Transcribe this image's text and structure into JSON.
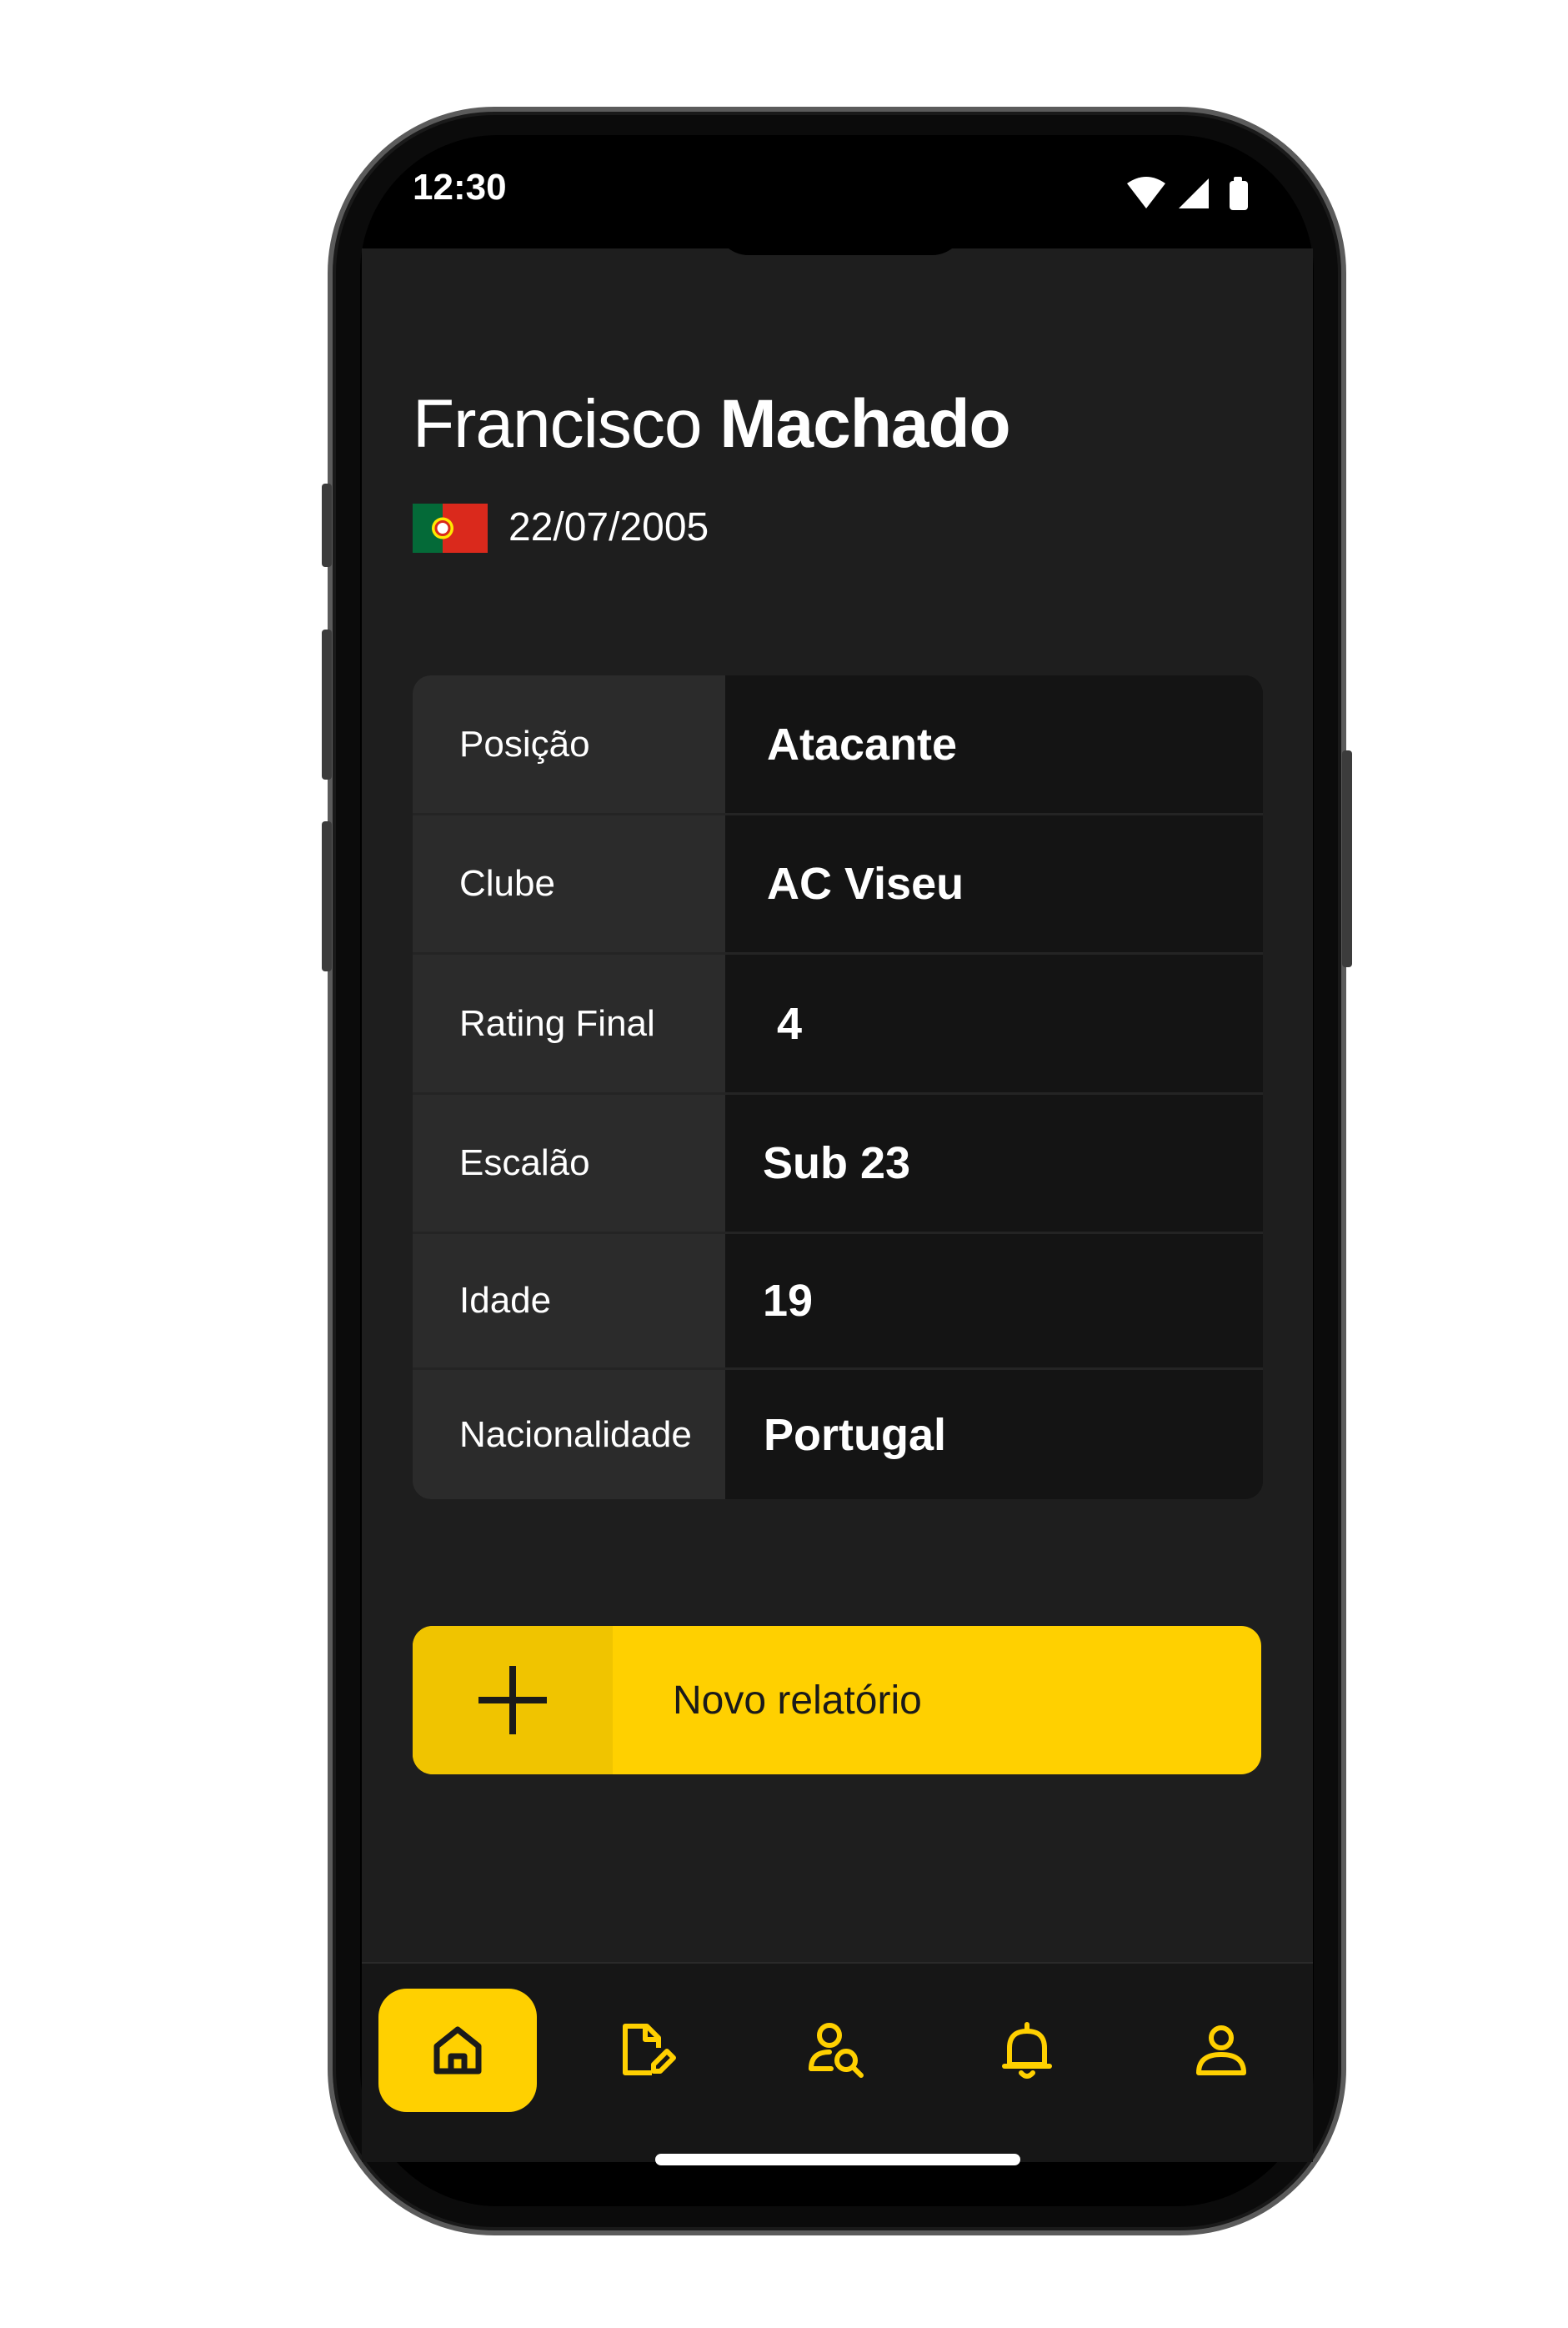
{
  "status_bar": {
    "time": "12:30"
  },
  "player": {
    "first_name": "Francisco",
    "last_name": "Machado",
    "birth_date": "22/07/2005",
    "flag_icon": "portugal-flag-icon"
  },
  "info_rows": [
    {
      "label": "Posição",
      "value": "Atacante"
    },
    {
      "label": "Clube",
      "value": "AC Viseu"
    },
    {
      "label": "Rating Final",
      "value": "4"
    },
    {
      "label": "Escalão",
      "value": "Sub 23"
    },
    {
      "label": "Idade",
      "value": "19"
    },
    {
      "label": "Nacionalidade",
      "value": "Portugal"
    }
  ],
  "actions": {
    "new_report_label": "Novo relatório"
  },
  "bottom_nav": {
    "active": "home",
    "items": [
      {
        "id": "home",
        "icon": "home-icon"
      },
      {
        "id": "reports",
        "icon": "edit-document-icon"
      },
      {
        "id": "scouting",
        "icon": "search-user-icon"
      },
      {
        "id": "notifications",
        "icon": "bell-icon"
      },
      {
        "id": "profile",
        "icon": "user-icon"
      }
    ]
  },
  "colors": {
    "accent": "#ffd000",
    "accent_dark": "#f0c400",
    "background": "#1e1e1e",
    "label_cell": "#2b2b2b",
    "value_cell": "#141414",
    "text": "#ffffff"
  }
}
